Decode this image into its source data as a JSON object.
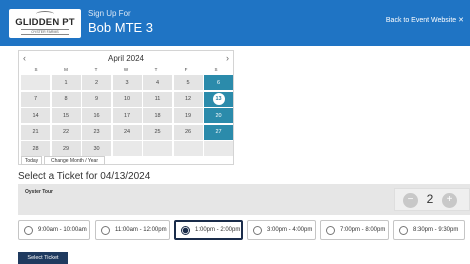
{
  "header": {
    "logo_main": "GLIDDEN PT",
    "logo_sub": "OYSTER FARMS",
    "sign_up_for": "Sign Up For",
    "event_name": "Bob MTE 3",
    "back_link": "Back to Event Website ✕"
  },
  "calendar": {
    "prev_icon": "‹",
    "next_icon": "›",
    "month_title": "April 2024",
    "weekdays": [
      "S",
      "M",
      "T",
      "W",
      "T",
      "F",
      "S"
    ],
    "days": [
      {
        "label": "",
        "state": "empty"
      },
      {
        "label": "1",
        "state": "default"
      },
      {
        "label": "2",
        "state": "default"
      },
      {
        "label": "3",
        "state": "default"
      },
      {
        "label": "4",
        "state": "default"
      },
      {
        "label": "5",
        "state": "default"
      },
      {
        "label": "6",
        "state": "available"
      },
      {
        "label": "7",
        "state": "default"
      },
      {
        "label": "8",
        "state": "default"
      },
      {
        "label": "9",
        "state": "default"
      },
      {
        "label": "10",
        "state": "default"
      },
      {
        "label": "11",
        "state": "default"
      },
      {
        "label": "12",
        "state": "default"
      },
      {
        "label": "13",
        "state": "selected"
      },
      {
        "label": "14",
        "state": "default"
      },
      {
        "label": "15",
        "state": "default"
      },
      {
        "label": "16",
        "state": "default"
      },
      {
        "label": "17",
        "state": "default"
      },
      {
        "label": "18",
        "state": "default"
      },
      {
        "label": "19",
        "state": "default"
      },
      {
        "label": "20",
        "state": "available"
      },
      {
        "label": "21",
        "state": "default"
      },
      {
        "label": "22",
        "state": "default"
      },
      {
        "label": "23",
        "state": "default"
      },
      {
        "label": "24",
        "state": "default"
      },
      {
        "label": "25",
        "state": "default"
      },
      {
        "label": "26",
        "state": "default"
      },
      {
        "label": "27",
        "state": "available"
      },
      {
        "label": "28",
        "state": "default"
      },
      {
        "label": "29",
        "state": "default"
      },
      {
        "label": "30",
        "state": "default"
      },
      {
        "label": "",
        "state": "empty"
      },
      {
        "label": "",
        "state": "empty"
      },
      {
        "label": "",
        "state": "empty"
      },
      {
        "label": "",
        "state": "empty"
      }
    ],
    "today_label": "Today",
    "change_label": "Change Month / Year"
  },
  "tickets": {
    "heading": "Select a Ticket for 04/13/2024",
    "ticket_name": "Oyster Tour",
    "quantity": "2",
    "minus_icon": "−",
    "plus_icon": "+",
    "time_slots": [
      {
        "label": "9:00am - 10:00am",
        "selected": false
      },
      {
        "label": "11:00am - 12:00pm",
        "selected": false
      },
      {
        "label": "1:00pm - 2:00pm",
        "selected": true
      },
      {
        "label": "3:00pm - 4:00pm",
        "selected": false
      },
      {
        "label": "7:00pm - 8:00pm",
        "selected": false
      },
      {
        "label": "8:30pm - 9:30pm",
        "selected": false
      }
    ],
    "select_button": "Select Ticket"
  },
  "colors": {
    "header_blue": "#1f74c4",
    "available_day": "#2b8bab",
    "selected_slot_border": "#1a2c4a",
    "button_navy": "#1f3a5f"
  }
}
